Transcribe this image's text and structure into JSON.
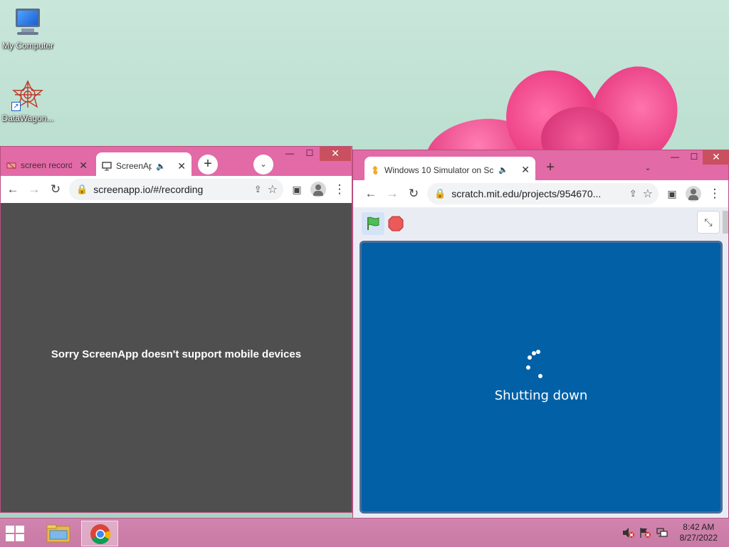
{
  "desktop": {
    "icons": [
      {
        "label": "My Computer",
        "icon": "computer-icon"
      },
      {
        "label": "DataWagon...",
        "icon": "datawagon-icon"
      }
    ]
  },
  "left_window": {
    "tabs": [
      {
        "title": "screen record",
        "favicon": "screen-record-favicon"
      },
      {
        "title": "ScreenAp",
        "favicon": "monitor-favicon",
        "audio": "🔈"
      }
    ],
    "new_tab": "+",
    "tab_search": "⌄",
    "url": "screenapp.io/#/recording",
    "message": "Sorry ScreenApp doesn't support mobile devices"
  },
  "right_window": {
    "tabs": [
      {
        "title": "Windows 10 Simulator on Sc",
        "favicon": "scratch-favicon",
        "audio": "🔈"
      }
    ],
    "new_tab": "+",
    "tab_search": "⌄",
    "url": "scratch.mit.edu/projects/954670...",
    "stage_text": "Shutting down"
  },
  "common": {
    "close_glyph": "✕",
    "minimize_glyph": "—",
    "maximize_glyph": "☐",
    "back_glyph": "←",
    "forward_glyph": "→",
    "reload_glyph": "↻",
    "share_glyph": "⇪",
    "star_glyph": "☆",
    "sidepanel_glyph": "▣",
    "menu_glyph": "⋮",
    "lock_glyph": "🔒"
  },
  "taskbar": {
    "time": "8:42 AM",
    "date": "8/27/2022"
  },
  "colors": {
    "window_frame": "#e26aa6",
    "stage_blue": "#0160a6",
    "dark_content": "#4f4f4f"
  }
}
